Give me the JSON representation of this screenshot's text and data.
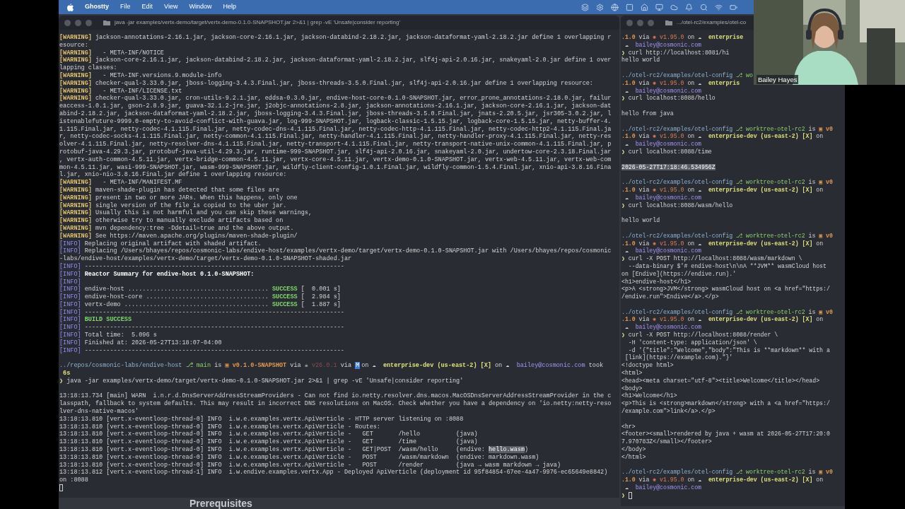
{
  "menu_bar": {
    "app": "Ghostty",
    "items": [
      "File",
      "Edit",
      "View",
      "Window",
      "Help"
    ]
  },
  "left_terminal": {
    "title": "java -jar examples/vertx-demo/target/vertx-demo-0.1.0-SNAPSHOT.jar 2>&1 | grep -vE 'Unsafe|consider reporting'",
    "lines": [
      {
        "spans": [
          {
            "text": "[WARNING]",
            "kind": "warn"
          },
          {
            "text": " jackson-annotations-2.16.1.jar, jackson-core-2.16.1.jar, jackson-databind-2.18.2.jar, jackson-dataformat-yaml-2.18.2.jar define 1 overlapping r"
          }
        ]
      },
      {
        "spans": [
          {
            "text": "esource:"
          }
        ]
      },
      {
        "spans": [
          {
            "text": "[WARNING]",
            "kind": "warn"
          },
          {
            "text": "   - META-INF/NOTICE"
          }
        ]
      },
      {
        "spans": [
          {
            "text": "[WARNING]",
            "kind": "warn"
          },
          {
            "text": " jackson-core-2.16.1.jar, jackson-databind-2.18.2.jar, jackson-dataformat-yaml-2.18.2.jar, slf4j-api-2.0.16.jar, snakeyaml-2.0.jar define 1 over"
          }
        ]
      },
      {
        "spans": [
          {
            "text": "lapping classes:"
          }
        ]
      },
      {
        "spans": [
          {
            "text": "[WARNING]",
            "kind": "warn"
          },
          {
            "text": "   - META-INF.versions.9.module-info"
          }
        ]
      },
      {
        "spans": [
          {
            "text": "[WARNING]",
            "kind": "warn"
          },
          {
            "text": " checker-qual-3.33.0.jar, jboss-logging-3.4.3.Final.jar, jboss-threads-3.5.0.Final.jar, slf4j-api-2.0.16.jar define 1 overlapping resource:"
          }
        ]
      },
      {
        "spans": [
          {
            "text": "[WARNING]",
            "kind": "warn"
          },
          {
            "text": "   - META-INF/LICENSE.txt"
          }
        ]
      },
      {
        "spans": [
          {
            "text": "[WARNING]",
            "kind": "warn"
          },
          {
            "text": " checker-qual-3.33.0.jar, cron-utils-9.2.1.jar, eddsa-0.3.0.jar, endive-host-core-0.1.0-SNAPSHOT.jar, error_prone_annotations-2.18.0.jar, failur"
          }
        ]
      },
      {
        "spans": [
          {
            "text": "eaccess-1.0.1.jar, gson-2.8.9.jar, guava-32.1.2-jre.jar, j2objc-annotations-2.8.jar, jackson-annotations-2.16.1.jar, jackson-core-2.16.1.jar, jackson-dat"
          }
        ]
      },
      {
        "spans": [
          {
            "text": "abind-2.18.2.jar, jackson-dataformat-yaml-2.18.2.jar, jboss-logging-3.4.3.Final.jar, jboss-threads-3.5.0.Final.jar, jnats-2.20.5.jar, jsr305-3.0.2.jar, l"
          }
        ]
      },
      {
        "spans": [
          {
            "text": "istenablefuture-9999.0-empty-to-avoid-conflict-with-guava.jar, log-999-SNAPSHOT.jar, logback-classic-1.5.15.jar, logback-core-1.5.15.jar, netty-buffer-4."
          }
        ]
      },
      {
        "spans": [
          {
            "text": "1.115.Final.jar, netty-codec-4.1.115.Final.jar, netty-codec-dns-4.1.115.Final.jar, netty-codec-http-4.1.115.Final.jar, netty-codec-http2-4.1.115.Final.ja"
          }
        ]
      },
      {
        "spans": [
          {
            "text": "r, netty-codec-socks-4.1.115.Final.jar, netty-common-4.1.115.Final.jar, netty-handler-4.1.115.Final.jar, netty-handler-proxy-4.1.115.Final.jar, netty-res"
          }
        ]
      },
      {
        "spans": [
          {
            "text": "olver-4.1.115.Final.jar, netty-resolver-dns-4.1.115.Final.jar, netty-transport-4.1.115.Final.jar, netty-transport-native-unix-common-4.1.115.Final.jar, p"
          }
        ]
      },
      {
        "spans": [
          {
            "text": "rotobuf-java-4.29.3.jar, protobuf-java-util-4.29.3.jar, runtime-999-SNAPSHOT.jar, slf4j-api-2.0.16.jar, snakeyaml-2.0.jar, undertow-core-2.3.18.Final.jar"
          }
        ]
      },
      {
        "spans": [
          {
            "text": ", vertx-auth-common-4.5.11.jar, vertx-bridge-common-4.5.11.jar, vertx-core-4.5.11.jar, vertx-demo-0.1.0-SNAPSHOT.jar, vertx-web-4.5.11.jar, vertx-web-com"
          }
        ]
      },
      {
        "spans": [
          {
            "text": "mon-4.5.11.jar, wasi-999-SNAPSHOT.jar, wasm-999-SNAPSHOT.jar, wildfly-client-config-1.0.1.Final.jar, wildfly-common-1.5.4.Final.jar, xnio-api-3.8.16.Fina"
          }
        ]
      },
      {
        "spans": [
          {
            "text": "l.jar, xnio-nio-3.8.16.Final.jar define 1 overlapping resource:"
          }
        ]
      },
      {
        "spans": [
          {
            "text": "[WARNING]",
            "kind": "warn"
          },
          {
            "text": "   - META-INF/MANIFEST.MF"
          }
        ]
      },
      {
        "spans": [
          {
            "text": "[WARNING]",
            "kind": "warn"
          },
          {
            "text": " maven-shade-plugin has detected that some files are"
          }
        ]
      },
      {
        "spans": [
          {
            "text": "[WARNING]",
            "kind": "warn"
          },
          {
            "text": " present in two or more JARs. When this happens, only one"
          }
        ]
      },
      {
        "spans": [
          {
            "text": "[WARNING]",
            "kind": "warn"
          },
          {
            "text": " single version of the file is copied to the uber jar."
          }
        ]
      },
      {
        "spans": [
          {
            "text": "[WARNING]",
            "kind": "warn"
          },
          {
            "text": " Usually this is not harmful and you can skip these warnings,"
          }
        ]
      },
      {
        "spans": [
          {
            "text": "[WARNING]",
            "kind": "warn"
          },
          {
            "text": " otherwise try to manually exclude artifacts based on"
          }
        ]
      },
      {
        "spans": [
          {
            "text": "[WARNING]",
            "kind": "warn"
          },
          {
            "text": " mvn dependency:tree -Ddetail=true and the above output."
          }
        ]
      },
      {
        "spans": [
          {
            "text": "[WARNING]",
            "kind": "warn"
          },
          {
            "text": " See https://maven.apache.org/plugins/maven-shade-plugin/"
          }
        ]
      },
      {
        "spans": [
          {
            "text": "[INFO]",
            "kind": "info"
          },
          {
            "text": " Replacing original artifact with shaded artifact."
          }
        ]
      },
      {
        "spans": [
          {
            "text": "[INFO]",
            "kind": "info"
          },
          {
            "text": " Replacing /Users/bhayes/repos/cosmonic-labs/endive-host/examples/vertx-demo/target/vertx-demo-0.1.0-SNAPSHOT.jar with /Users/bhayes/repos/cosmonic"
          }
        ]
      },
      {
        "spans": [
          {
            "text": "-labs/endive-host/examples/vertx-demo/target/vertx-demo-0.1.0-SNAPSHOT-shaded.jar"
          }
        ]
      },
      {
        "spans": [
          {
            "text": "[INFO]",
            "kind": "info"
          },
          {
            "text": " ------------------------------------------------------------------------"
          }
        ]
      },
      {
        "spans": [
          {
            "text": "[INFO]",
            "kind": "info"
          },
          {
            "text": " Reactor Summary for endive-host 0.1.0-SNAPSHOT:",
            "kind": "bold"
          }
        ]
      },
      {
        "spans": [
          {
            "text": "[INFO]",
            "kind": "info"
          }
        ]
      },
      {
        "spans": [
          {
            "text": "[INFO]",
            "kind": "info"
          },
          {
            "text": " endive-host ....................................... "
          },
          {
            "text": "SUCCESS",
            "kind": "success"
          },
          {
            "text": " [  0.001 s]"
          }
        ]
      },
      {
        "spans": [
          {
            "text": "[INFO]",
            "kind": "info"
          },
          {
            "text": " endive-host-core .................................. "
          },
          {
            "text": "SUCCESS",
            "kind": "success"
          },
          {
            "text": " [  2.984 s]"
          }
        ]
      },
      {
        "spans": [
          {
            "text": "[INFO]",
            "kind": "info"
          },
          {
            "text": " vertx-demo ........................................ "
          },
          {
            "text": "SUCCESS",
            "kind": "success"
          },
          {
            "text": " [  1.887 s]"
          }
        ]
      },
      {
        "spans": [
          {
            "text": "[INFO]",
            "kind": "info"
          },
          {
            "text": " ------------------------------------------------------------------------"
          }
        ]
      },
      {
        "spans": [
          {
            "text": "[INFO]",
            "kind": "info"
          },
          {
            "text": " BUILD SUCCESS",
            "kind": "success"
          }
        ]
      },
      {
        "spans": [
          {
            "text": "[INFO]",
            "kind": "info"
          },
          {
            "text": " ------------------------------------------------------------------------"
          }
        ]
      },
      {
        "spans": [
          {
            "text": "[INFO]",
            "kind": "info"
          },
          {
            "text": " Total time:  5.096 s"
          }
        ]
      },
      {
        "spans": [
          {
            "text": "[INFO]",
            "kind": "info"
          },
          {
            "text": " Finished at: 2026-05-27T13:18:07-04:00"
          }
        ]
      },
      {
        "spans": [
          {
            "text": "[INFO]",
            "kind": "info"
          },
          {
            "text": " ------------------------------------------------------------------------"
          }
        ]
      },
      {
        "kind": "blank"
      },
      {
        "spans": [
          {
            "text": "../repos/cosmonic-labs/endive-host ",
            "kind": "path"
          },
          {
            "text": "⎇ main",
            "kind": "branch"
          },
          {
            "text": " is "
          },
          {
            "text": "▣ v0.1.0-SNAPSHOT",
            "kind": "version"
          },
          {
            "text": " via ☕ "
          },
          {
            "text": "v26.0.1",
            "kind": "dim"
          },
          {
            "text": " via "
          },
          {
            "text": "M",
            "kind": "badge"
          },
          {
            "text": "on ☁  "
          },
          {
            "text": "enterprise-dev (us-east-2) [X]",
            "kind": "env"
          },
          {
            "text": " on ☁  "
          },
          {
            "text": "bailey@cosmonic.com",
            "kind": "user"
          },
          {
            "text": " took"
          }
        ]
      },
      {
        "spans": [
          {
            "text": " 6s",
            "kind": "env"
          }
        ]
      },
      {
        "spans": [
          {
            "text": "❯",
            "kind": "prompt"
          },
          {
            "text": " java -jar examples/vertx-demo/target/vertx-demo-0.1.0-SNAPSHOT.jar 2>&1 | grep -vE 'Unsafe|consider reporting'"
          }
        ]
      },
      {
        "kind": "blank"
      },
      {
        "spans": [
          {
            "text": "13:18:13.734 [main] WARN  i.n.r.d.DnsServerAddressStreamProviders - Can not find io.netty.resolver.dns.macos.MacOSDnsServerAddressStreamProvider in the c"
          }
        ]
      },
      {
        "spans": [
          {
            "text": "lasspath, fallback to system defaults. This may result in incorrect DNS resolutions on MacOS. Check whether you have a dependency on 'io.netty:netty-reso"
          }
        ]
      },
      {
        "spans": [
          {
            "text": "lver-dns-native-macos'"
          }
        ]
      },
      {
        "spans": [
          {
            "text": "13:18:13.810 [vert.x-eventloop-thread-0] INFO  i.w.e.examples.vertx.ApiVerticle - HTTP server listening on :8088"
          }
        ]
      },
      {
        "spans": [
          {
            "text": "13:18:13.810 [vert.x-eventloop-thread-0] INFO  i.w.e.examples.vertx.ApiVerticle - Routes:"
          }
        ]
      },
      {
        "spans": [
          {
            "text": "13:18:13.810 [vert.x-eventloop-thread-0] INFO  i.w.e.examples.vertx.ApiVerticle -   GET       /hello          (java)"
          }
        ]
      },
      {
        "spans": [
          {
            "text": "13:18:13.810 [vert.x-eventloop-thread-0] INFO  i.w.e.examples.vertx.ApiVerticle -   GET       /time           (java)"
          }
        ]
      },
      {
        "spans": [
          {
            "text": "13:18:13.810 [vert.x-eventloop-thread-0] INFO  i.w.e.examples.vertx.ApiVerticle -   GET|POST  /wasm/hello     (endive: "
          },
          {
            "text": "hello.wasm",
            "kind": "selected"
          },
          {
            "text": ")"
          }
        ]
      },
      {
        "spans": [
          {
            "text": "13:18:13.810 [vert.x-eventloop-thread-0] INFO  i.w.e.examples.vertx.ApiVerticle -   POST      /wasm/markdown  (endive: markdown.wasm)"
          }
        ]
      },
      {
        "spans": [
          {
            "text": "13:18:13.810 [vert.x-eventloop-thread-0] INFO  i.w.e.examples.vertx.ApiVerticle -   POST      /render         (java → wasm markdown → java)"
          }
        ]
      },
      {
        "spans": [
          {
            "text": "13:18:13.812 [vert.x-eventloop-thread-1] INFO  i.w.endive.examples.vertx.App - Deployed ApiVerticle (deployment id 95f84854-67ee-4a47-9976-ec65649e8842)"
          }
        ]
      },
      {
        "spans": [
          {
            "text": "on :8088"
          }
        ]
      },
      {
        "kind": "cursor"
      }
    ]
  },
  "right_terminal": {
    "title": ".../otel-rc2/examples/otel-co",
    "lines": [
      {
        "spans": [
          {
            "text": ".1.0",
            "kind": "version"
          },
          {
            "text": " via "
          },
          {
            "text": "✺ v1.95.0",
            "kind": "rust"
          },
          {
            "text": " on ☁  "
          },
          {
            "text": "enterprise",
            "kind": "env"
          }
        ]
      },
      {
        "spans": [
          {
            "text": " ☁  "
          },
          {
            "text": "bailey@cosmonic.com",
            "kind": "user"
          }
        ]
      },
      {
        "spans": [
          {
            "text": "❯",
            "kind": "prompt"
          },
          {
            "text": " curl http://localhost:8081/hi"
          }
        ]
      },
      {
        "spans": [
          {
            "text": "hello world"
          }
        ]
      },
      {
        "kind": "blank"
      },
      {
        "spans": [
          {
            "text": "../otel-rc2/examples/otel-config ",
            "kind": "path"
          },
          {
            "text": "⎇ wo",
            "kind": "branch"
          }
        ]
      },
      {
        "spans": [
          {
            "text": ".1.0",
            "kind": "version"
          },
          {
            "text": " via "
          },
          {
            "text": "✺ v1.95.0",
            "kind": "rust"
          },
          {
            "text": " on ☁  "
          },
          {
            "text": "enterpris",
            "kind": "env"
          }
        ]
      },
      {
        "spans": [
          {
            "text": " ☁  "
          },
          {
            "text": "bailey@cosmonic.com",
            "kind": "user"
          }
        ]
      },
      {
        "spans": [
          {
            "text": "❯",
            "kind": "prompt"
          },
          {
            "text": " curl localhost:8088/hello"
          }
        ]
      },
      {
        "kind": "blank"
      },
      {
        "spans": [
          {
            "text": "hello from java"
          }
        ]
      },
      {
        "kind": "blank"
      },
      {
        "spans": [
          {
            "text": "../otel-rc2/examples/otel-config ",
            "kind": "path"
          },
          {
            "text": "⎇ worktree-otel-rc2",
            "kind": "branch"
          },
          {
            "text": " is "
          },
          {
            "text": "▣ v0",
            "kind": "version"
          }
        ]
      },
      {
        "spans": [
          {
            "text": ".1.0",
            "kind": "version"
          },
          {
            "text": " via "
          },
          {
            "text": "✺ v1.95.0",
            "kind": "rust"
          },
          {
            "text": " on ☁  "
          },
          {
            "text": "enterprise-dev (us-east-2) [X]",
            "kind": "env"
          },
          {
            "text": " on"
          }
        ]
      },
      {
        "spans": [
          {
            "text": " ☁  "
          },
          {
            "text": "bailey@cosmonic.com",
            "kind": "user"
          }
        ]
      },
      {
        "spans": [
          {
            "text": "❯",
            "kind": "prompt"
          },
          {
            "text": " curl localhost:8088/time"
          }
        ]
      },
      {
        "kind": "blank"
      },
      {
        "spans": [
          {
            "text": "2026-05-27T17:18:46.534956Z",
            "kind": "selected"
          }
        ]
      },
      {
        "kind": "blank"
      },
      {
        "spans": [
          {
            "text": "../otel-rc2/examples/otel-config ",
            "kind": "path"
          },
          {
            "text": "⎇ worktree-otel-rc2",
            "kind": "branch"
          },
          {
            "text": " is "
          },
          {
            "text": "▣ v0",
            "kind": "version"
          }
        ]
      },
      {
        "spans": [
          {
            "text": ".1.0",
            "kind": "version"
          },
          {
            "text": " via "
          },
          {
            "text": "✺ v1.95.0",
            "kind": "rust"
          },
          {
            "text": " on ☁  "
          },
          {
            "text": "enterprise-dev (us-east-2) [X]",
            "kind": "env"
          },
          {
            "text": " on"
          }
        ]
      },
      {
        "spans": [
          {
            "text": " ☁  "
          },
          {
            "text": "bailey@cosmonic.com",
            "kind": "user"
          }
        ]
      },
      {
        "spans": [
          {
            "text": "❯",
            "kind": "prompt"
          },
          {
            "text": " curl localhost:8088/wasm/hello"
          }
        ]
      },
      {
        "kind": "blank"
      },
      {
        "spans": [
          {
            "text": "hello world"
          }
        ]
      },
      {
        "kind": "blank"
      },
      {
        "spans": [
          {
            "text": "../otel-rc2/examples/otel-config ",
            "kind": "path"
          },
          {
            "text": "⎇ worktree-otel-rc2",
            "kind": "branch"
          },
          {
            "text": " is "
          },
          {
            "text": "▣ v0",
            "kind": "version"
          }
        ]
      },
      {
        "spans": [
          {
            "text": ".1.0",
            "kind": "version"
          },
          {
            "text": " via "
          },
          {
            "text": "✺ v1.95.0",
            "kind": "rust"
          },
          {
            "text": " on ☁  "
          },
          {
            "text": "enterprise-dev (us-east-2) [X]",
            "kind": "env"
          },
          {
            "text": " on"
          }
        ]
      },
      {
        "spans": [
          {
            "text": " ☁  "
          },
          {
            "text": "bailey@cosmonic.com",
            "kind": "user"
          }
        ]
      },
      {
        "spans": [
          {
            "text": "❯",
            "kind": "prompt"
          },
          {
            "text": " curl -X POST http://localhost:8088/wasm/markdown \\"
          }
        ]
      },
      {
        "spans": [
          {
            "text": "  --data-binary $'# endive-host\\n\\nA **JVM** wasmCloud host"
          }
        ]
      },
      {
        "spans": [
          {
            "text": "on [Endive](https://endive.run).'"
          }
        ]
      },
      {
        "spans": [
          {
            "text": "<h1>endive-host</h1>"
          }
        ]
      },
      {
        "spans": [
          {
            "text": "<p>A <strong>JVM</strong> wasmCloud host on <a href=\"https:/"
          }
        ]
      },
      {
        "spans": [
          {
            "text": "/endive.run\">Endive</a>.</p>"
          }
        ]
      },
      {
        "kind": "blank"
      },
      {
        "spans": [
          {
            "text": "../otel-rc2/examples/otel-config ",
            "kind": "path"
          },
          {
            "text": "⎇ worktree-otel-rc2",
            "kind": "branch"
          },
          {
            "text": " is "
          },
          {
            "text": "▣ v0",
            "kind": "version"
          }
        ]
      },
      {
        "spans": [
          {
            "text": ".1.0",
            "kind": "version"
          },
          {
            "text": " via "
          },
          {
            "text": "✺ v1.95.0",
            "kind": "rust"
          },
          {
            "text": " on ☁  "
          },
          {
            "text": "enterprise-dev (us-east-2) [X]",
            "kind": "env"
          },
          {
            "text": " on"
          }
        ]
      },
      {
        "spans": [
          {
            "text": " ☁  "
          },
          {
            "text": "bailey@cosmonic.com",
            "kind": "user"
          }
        ]
      },
      {
        "spans": [
          {
            "text": "❯",
            "kind": "prompt"
          },
          {
            "text": " curl -X POST http://localhost:8088/render \\"
          }
        ]
      },
      {
        "spans": [
          {
            "text": "  -H 'content-type: application/json' \\"
          }
        ]
      },
      {
        "spans": [
          {
            "text": "  -d '{\"title\":\"Welcome\",\"body\":\"This is **markdown** with a"
          }
        ]
      },
      {
        "spans": [
          {
            "text": " [link](https://example.com).\"}'"
          }
        ]
      },
      {
        "spans": [
          {
            "text": "<!doctype html>"
          }
        ]
      },
      {
        "spans": [
          {
            "text": "<html>"
          }
        ]
      },
      {
        "spans": [
          {
            "text": "<head><meta charset=\"utf-8\"><title>Welcome</title></head>"
          }
        ]
      },
      {
        "spans": [
          {
            "text": "<body>"
          }
        ]
      },
      {
        "spans": [
          {
            "text": "<h1>Welcome</h1>"
          }
        ]
      },
      {
        "spans": [
          {
            "text": "<p>This is <strong>markdown</strong> with a <a href=\"https:/"
          }
        ]
      },
      {
        "spans": [
          {
            "text": "/example.com\">link</a>.</p>"
          }
        ]
      },
      {
        "kind": "blank"
      },
      {
        "spans": [
          {
            "text": "<hr>"
          }
        ]
      },
      {
        "spans": [
          {
            "text": "<footer><small>rendered by java + wasm at 2026-05-27T17:20:0"
          }
        ]
      },
      {
        "spans": [
          {
            "text": "7.970783Z</small></footer>"
          }
        ]
      },
      {
        "spans": [
          {
            "text": "</body>"
          }
        ]
      },
      {
        "spans": [
          {
            "text": "</html>"
          }
        ]
      },
      {
        "kind": "blank"
      },
      {
        "spans": [
          {
            "text": "../otel-rc2/examples/otel-config ",
            "kind": "path"
          },
          {
            "text": "⎇ worktree-otel-rc2",
            "kind": "branch"
          },
          {
            "text": " is "
          },
          {
            "text": "▣ v0",
            "kind": "version"
          }
        ]
      },
      {
        "spans": [
          {
            "text": ".1.0",
            "kind": "version"
          },
          {
            "text": " via "
          },
          {
            "text": "✺ v1.95.0",
            "kind": "rust"
          },
          {
            "text": " on ☁  "
          },
          {
            "text": "enterprise-dev (us-east-2) [X]",
            "kind": "env"
          },
          {
            "text": " on"
          }
        ]
      },
      {
        "spans": [
          {
            "text": " ☁  "
          },
          {
            "text": "bailey@cosmonic.com",
            "kind": "user"
          }
        ]
      },
      {
        "kind": "cursor",
        "spans": [
          {
            "text": "❯",
            "kind": "prompt"
          }
        ]
      }
    ]
  },
  "background_document": {
    "heading": "Prerequisites"
  },
  "video_tile": {
    "kind": "picture",
    "participant_name": "Bailey Hayes"
  }
}
